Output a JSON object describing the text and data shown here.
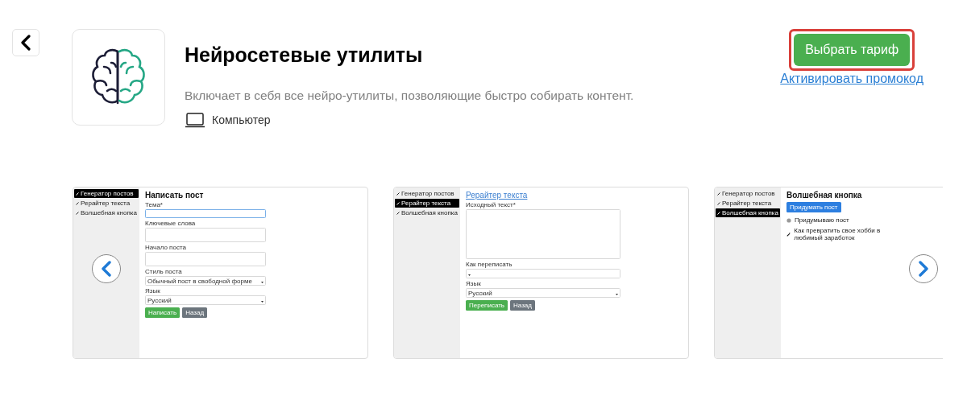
{
  "app": {
    "title": "Нейросетевые утилиты",
    "description": "Включает в себя все нейро-утилиты, позволяющие быстро собирать контент.",
    "platform": "Компьютер"
  },
  "actions": {
    "button": "Выбрать тариф",
    "highlighted": true,
    "link": "Активировать промокод"
  },
  "slides": [
    {
      "kind": "form",
      "title": "Написать пост",
      "title_link": false,
      "sidebar": [
        {
          "label": "Генератор постов",
          "selected": true
        },
        {
          "label": "Рерайтер текста",
          "selected": false
        },
        {
          "label": "Волшебная кнопка",
          "selected": false
        }
      ],
      "fields": [
        {
          "label": "Тема*",
          "kind": "input",
          "focused": true
        },
        {
          "label": "Ключевые слова",
          "kind": "textarea"
        },
        {
          "label": "Начало поста",
          "kind": "textarea"
        },
        {
          "label": "Стиль поста",
          "kind": "select",
          "value": "Обычный пост в свободной форме"
        },
        {
          "label": "Язык",
          "kind": "select",
          "value": "Русский"
        }
      ],
      "buttons": [
        {
          "label": "Написать",
          "kind": "primary"
        },
        {
          "label": "Назад",
          "kind": "secondary"
        }
      ]
    },
    {
      "kind": "form",
      "title": "Рерайтер текста",
      "title_link": true,
      "sidebar": [
        {
          "label": "Генератор постов",
          "selected": false
        },
        {
          "label": "Рерайтер текста",
          "selected": true
        },
        {
          "label": "Волшебная кнопка",
          "selected": false
        }
      ],
      "fields": [
        {
          "label": "Исходный текст*",
          "kind": "bigtextarea"
        },
        {
          "label": "Как переписать",
          "kind": "select"
        },
        {
          "label": "Язык",
          "kind": "select",
          "value": "Русский"
        }
      ],
      "buttons": [
        {
          "label": "Переписать",
          "kind": "primary"
        },
        {
          "label": "Назад",
          "kind": "secondary"
        }
      ]
    },
    {
      "kind": "list",
      "title": "Волшебная кнопка",
      "title_link": false,
      "sidebar": [
        {
          "label": "Генератор постов",
          "selected": false
        },
        {
          "label": "Рерайтер текста",
          "selected": false
        },
        {
          "label": "Волшебная кнопка",
          "selected": true
        }
      ],
      "button": "Придумать пост",
      "items": [
        {
          "label": "Придумываю пост",
          "kind": "pending"
        },
        {
          "label": "Как превратить свое хобби в любимый заработок",
          "kind": "done"
        }
      ]
    }
  ]
}
